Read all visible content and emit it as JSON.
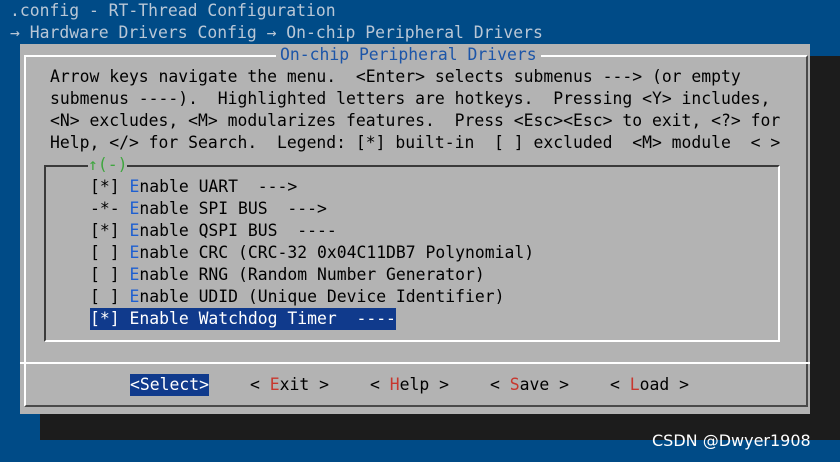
{
  "header": {
    "config_title": ".config - RT-Thread Configuration",
    "breadcrumb": "→ Hardware Drivers Config → On-chip Peripheral Drivers"
  },
  "dialog": {
    "title": "On-chip Peripheral Drivers",
    "help_lines": [
      "Arrow keys navigate the menu.  <Enter> selects submenus ---> (or empty",
      "submenus ----).  Highlighted letters are hotkeys.  Pressing <Y> includes,",
      "<N> excludes, <M> modularizes features.  Press <Esc><Esc> to exit, <?> for",
      "Help, </> for Search.  Legend: [*] built-in  [ ] excluded  <M> module  < >"
    ],
    "scroll_indicator": "↑(-)"
  },
  "menu": {
    "items": [
      {
        "prefix": "[*] ",
        "hotkey": "E",
        "rest": "nable UART  --->"
      },
      {
        "prefix": "-*- ",
        "hotkey": "E",
        "rest": "nable SPI BUS  --->"
      },
      {
        "prefix": "[*] ",
        "hotkey": "E",
        "rest": "nable QSPI BUS  ----"
      },
      {
        "prefix": "[ ] ",
        "hotkey": "E",
        "rest": "nable CRC (CRC-32 0x04C11DB7 Polynomial)"
      },
      {
        "prefix": "[ ] ",
        "hotkey": "E",
        "rest": "nable RNG (Random Number Generator)"
      },
      {
        "prefix": "[ ] ",
        "hotkey": "E",
        "rest": "nable UDID (Unique Device Identifier)"
      },
      {
        "prefix": "[*] ",
        "hotkey": "E",
        "rest": "nable Watchdog Timer  ----"
      }
    ],
    "selected_index": 6
  },
  "buttons": [
    {
      "open": "<",
      "hotkey": "S",
      "rest": "elect",
      "close": ">"
    },
    {
      "open": "< ",
      "hotkey": "E",
      "rest": "xit",
      "close": " >"
    },
    {
      "open": "< ",
      "hotkey": "H",
      "rest": "elp",
      "close": " >"
    },
    {
      "open": "< ",
      "hotkey": "S",
      "rest": "ave",
      "close": " >"
    },
    {
      "open": "< ",
      "hotkey": "L",
      "rest": "oad",
      "close": " >"
    }
  ],
  "watermark": "CSDN @Dwyer1908",
  "colors": {
    "background": "#004b87",
    "dialog": "#b3b3b3",
    "selection": "#103a8c",
    "menu_hotkey": "#1d5fd1",
    "button_hotkey": "#c8372e",
    "title": "#1c55a8"
  }
}
